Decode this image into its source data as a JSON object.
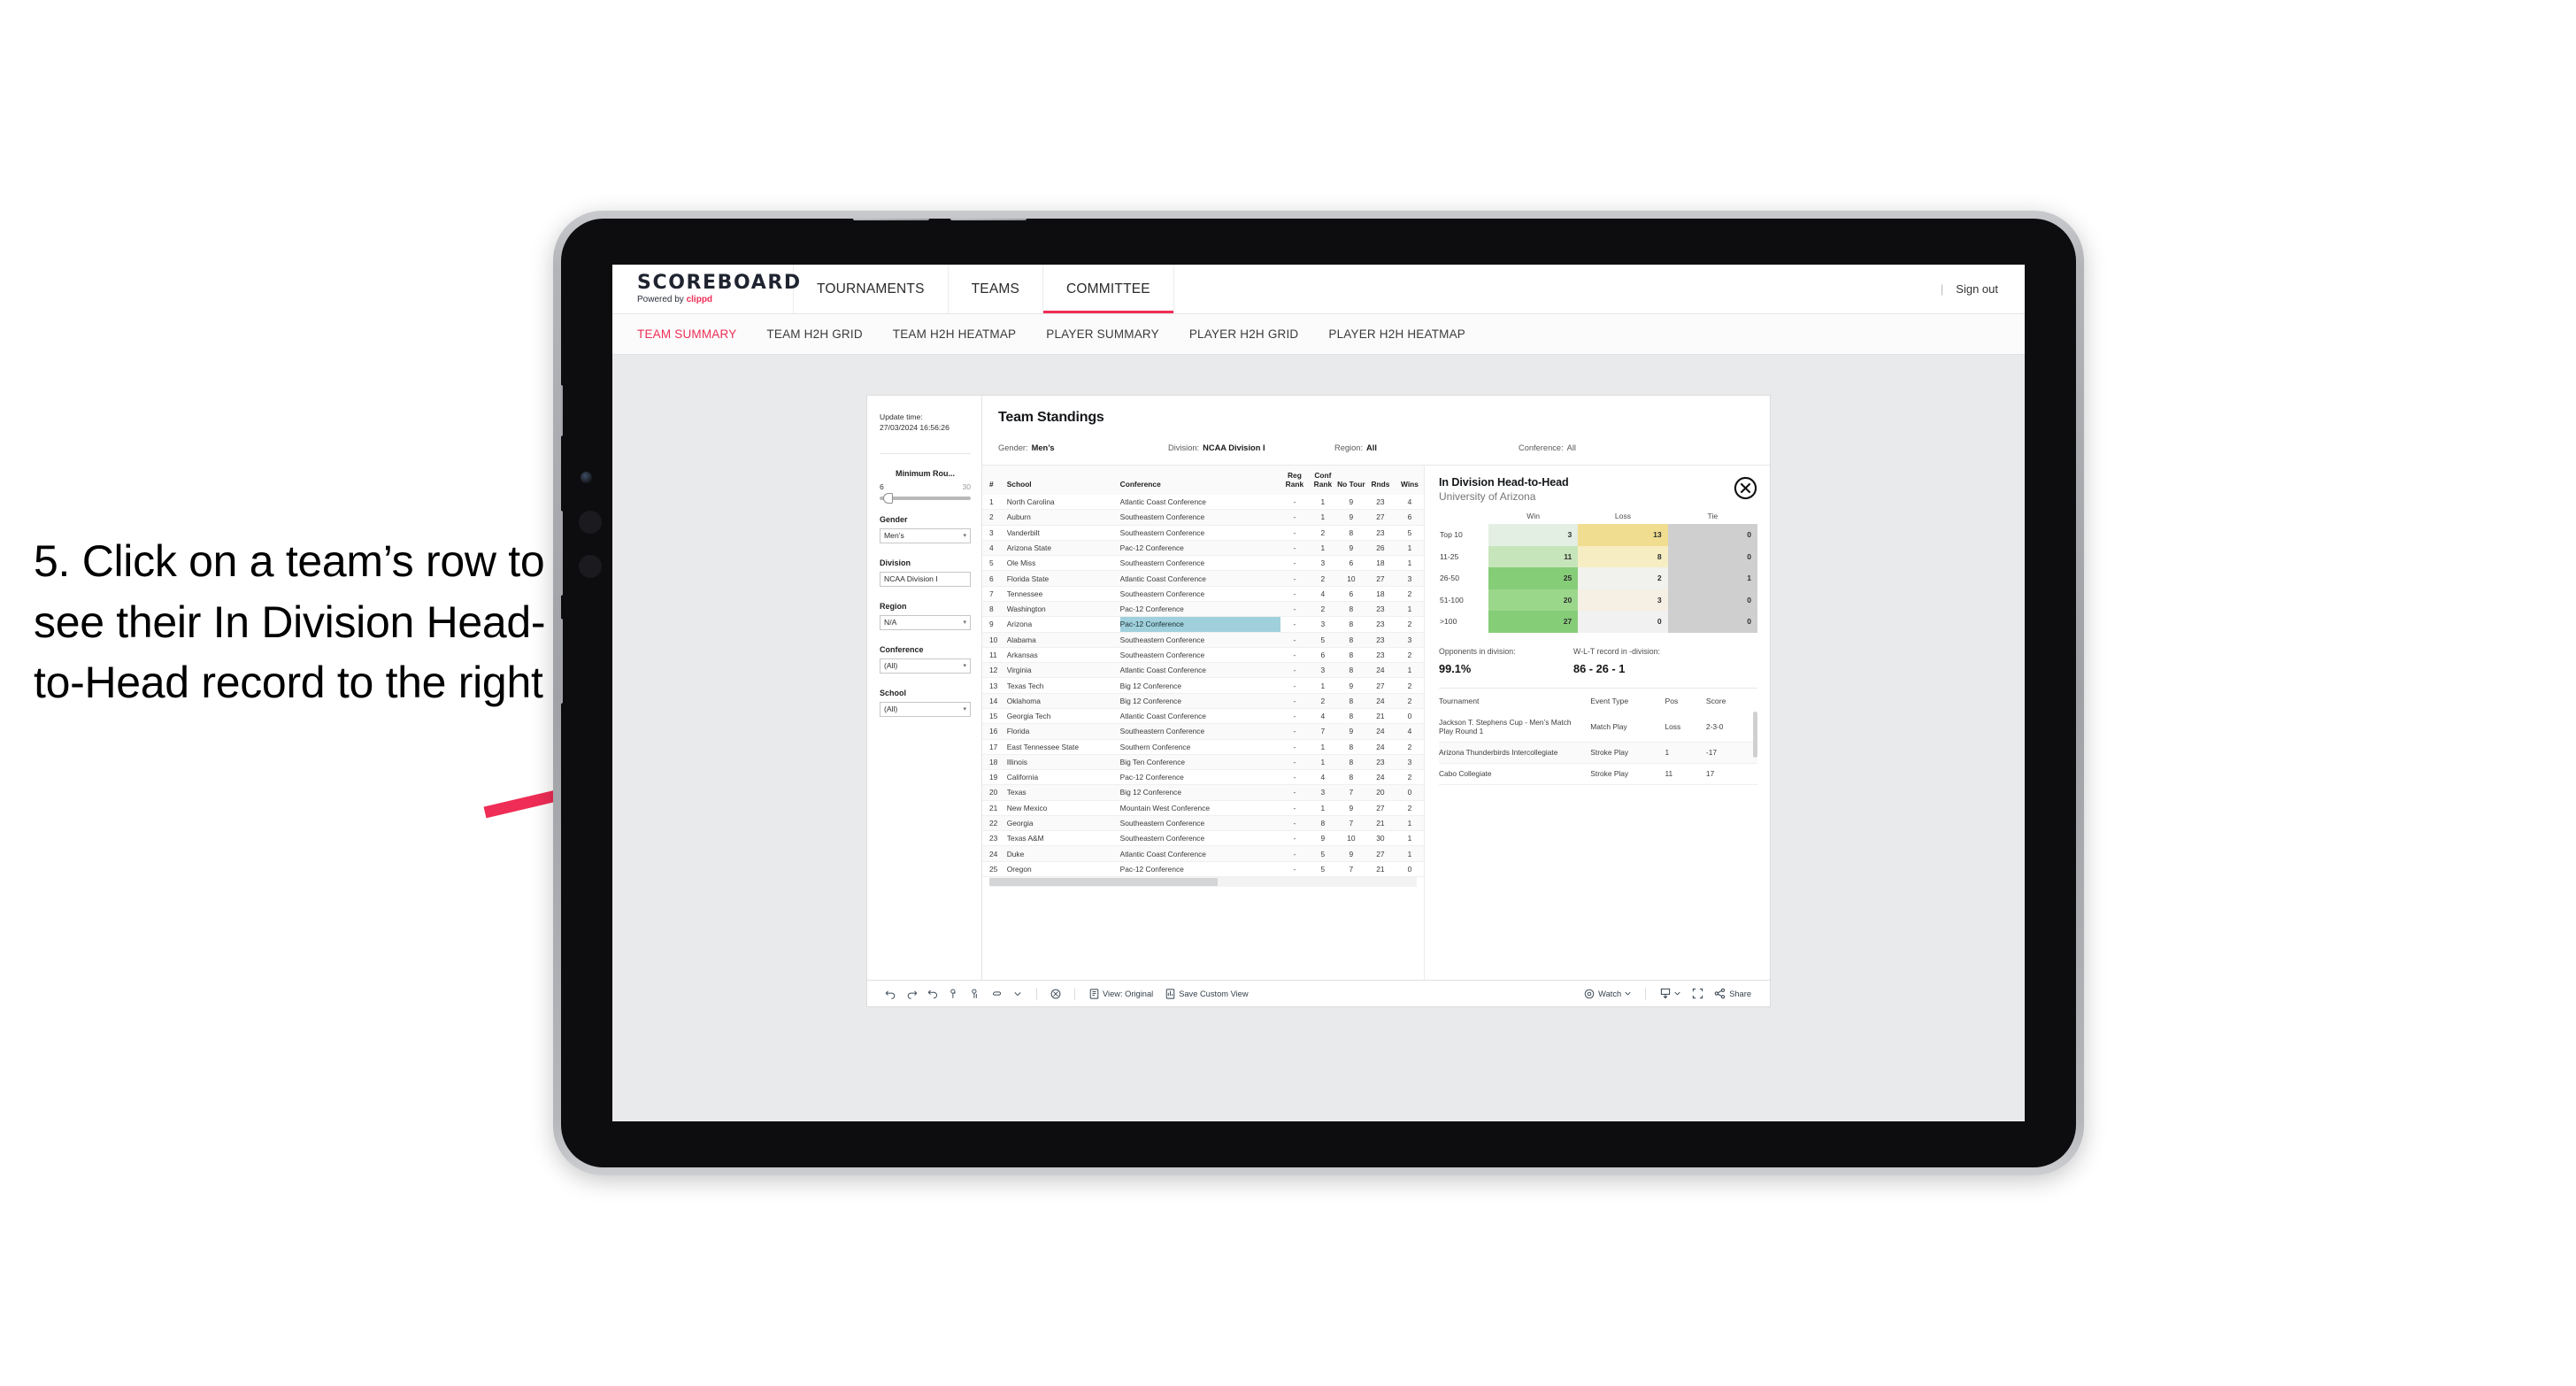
{
  "annotation": {
    "text": "5. Click on a team’s row to see their In Division Head-to-Head record to the right",
    "arrow_color": "#ef2d56"
  },
  "topnav": {
    "brand_title": "SCOREBOARD",
    "brand_sub_prefix": "Powered by ",
    "brand_sub_brand": "clippd",
    "links": [
      {
        "label": "TOURNAMENTS",
        "active": false
      },
      {
        "label": "TEAMS",
        "active": false
      },
      {
        "label": "COMMITTEE",
        "active": true
      }
    ],
    "separator": "|",
    "sign_out": "Sign out"
  },
  "subnav": {
    "tabs": [
      {
        "label": "TEAM SUMMARY",
        "active": true
      },
      {
        "label": "TEAM H2H GRID",
        "active": false
      },
      {
        "label": "TEAM H2H HEATMAP",
        "active": false
      },
      {
        "label": "PLAYER SUMMARY",
        "active": false
      },
      {
        "label": "PLAYER H2H GRID",
        "active": false
      },
      {
        "label": "PLAYER H2H HEATMAP",
        "active": false
      }
    ]
  },
  "sidebar": {
    "update_time_label": "Update time:",
    "update_time_value": "27/03/2024 16:56:26",
    "slider": {
      "label": "Minimum Rou...",
      "min": "6",
      "max": "30",
      "value_pct": 4
    },
    "filters": [
      {
        "label": "Gender",
        "value": "Men’s",
        "caret": "▾"
      },
      {
        "label": "Division",
        "value": "NCAA Division I",
        "caret": ""
      },
      {
        "label": "Region",
        "value": "N/A",
        "caret": "▾"
      },
      {
        "label": "Conference",
        "value": "(All)",
        "caret": "▾"
      },
      {
        "label": "School",
        "value": "(All)",
        "caret": "▾"
      }
    ]
  },
  "standings": {
    "title": "Team Standings",
    "meta": [
      {
        "key": "Gender:",
        "value": "Men’s"
      },
      {
        "key": "Division:",
        "value": "NCAA Division I"
      },
      {
        "key": "Region:",
        "value": "All"
      },
      {
        "key": "Conference:",
        "value": "All"
      }
    ],
    "columns": [
      "#",
      "School",
      "Conference",
      "Reg Rank",
      "Conf Rank",
      "No Tour",
      "Rnds",
      "Wins"
    ],
    "rows": [
      {
        "rank": "1",
        "school": "North Carolina",
        "conf": "Atlantic Coast Conference",
        "reg": "-",
        "cfr": "1",
        "notour": "9",
        "rnds": "23",
        "wins": "4"
      },
      {
        "rank": "2",
        "school": "Auburn",
        "conf": "Southeastern Conference",
        "reg": "-",
        "cfr": "1",
        "notour": "9",
        "rnds": "27",
        "wins": "6"
      },
      {
        "rank": "3",
        "school": "Vanderbilt",
        "conf": "Southeastern Conference",
        "reg": "-",
        "cfr": "2",
        "notour": "8",
        "rnds": "23",
        "wins": "5"
      },
      {
        "rank": "4",
        "school": "Arizona State",
        "conf": "Pac-12 Conference",
        "reg": "-",
        "cfr": "1",
        "notour": "9",
        "rnds": "26",
        "wins": "1"
      },
      {
        "rank": "5",
        "school": "Ole Miss",
        "conf": "Southeastern Conference",
        "reg": "-",
        "cfr": "3",
        "notour": "6",
        "rnds": "18",
        "wins": "1"
      },
      {
        "rank": "6",
        "school": "Florida State",
        "conf": "Atlantic Coast Conference",
        "reg": "-",
        "cfr": "2",
        "notour": "10",
        "rnds": "27",
        "wins": "3"
      },
      {
        "rank": "7",
        "school": "Tennessee",
        "conf": "Southeastern Conference",
        "reg": "-",
        "cfr": "4",
        "notour": "6",
        "rnds": "18",
        "wins": "2"
      },
      {
        "rank": "8",
        "school": "Washington",
        "conf": "Pac-12 Conference",
        "reg": "-",
        "cfr": "2",
        "notour": "8",
        "rnds": "23",
        "wins": "1"
      },
      {
        "rank": "9",
        "school": "Arizona",
        "conf": "Pac-12 Conference",
        "reg": "-",
        "cfr": "3",
        "notour": "8",
        "rnds": "23",
        "wins": "2",
        "selected": true
      },
      {
        "rank": "10",
        "school": "Alabama",
        "conf": "Southeastern Conference",
        "reg": "-",
        "cfr": "5",
        "notour": "8",
        "rnds": "23",
        "wins": "3"
      },
      {
        "rank": "11",
        "school": "Arkansas",
        "conf": "Southeastern Conference",
        "reg": "-",
        "cfr": "6",
        "notour": "8",
        "rnds": "23",
        "wins": "2"
      },
      {
        "rank": "12",
        "school": "Virginia",
        "conf": "Atlantic Coast Conference",
        "reg": "-",
        "cfr": "3",
        "notour": "8",
        "rnds": "24",
        "wins": "1"
      },
      {
        "rank": "13",
        "school": "Texas Tech",
        "conf": "Big 12 Conference",
        "reg": "-",
        "cfr": "1",
        "notour": "9",
        "rnds": "27",
        "wins": "2"
      },
      {
        "rank": "14",
        "school": "Oklahoma",
        "conf": "Big 12 Conference",
        "reg": "-",
        "cfr": "2",
        "notour": "8",
        "rnds": "24",
        "wins": "2"
      },
      {
        "rank": "15",
        "school": "Georgia Tech",
        "conf": "Atlantic Coast Conference",
        "reg": "-",
        "cfr": "4",
        "notour": "8",
        "rnds": "21",
        "wins": "0"
      },
      {
        "rank": "16",
        "school": "Florida",
        "conf": "Southeastern Conference",
        "reg": "-",
        "cfr": "7",
        "notour": "9",
        "rnds": "24",
        "wins": "4"
      },
      {
        "rank": "17",
        "school": "East Tennessee State",
        "conf": "Southern Conference",
        "reg": "-",
        "cfr": "1",
        "notour": "8",
        "rnds": "24",
        "wins": "2"
      },
      {
        "rank": "18",
        "school": "Illinois",
        "conf": "Big Ten Conference",
        "reg": "-",
        "cfr": "1",
        "notour": "8",
        "rnds": "23",
        "wins": "3"
      },
      {
        "rank": "19",
        "school": "California",
        "conf": "Pac-12 Conference",
        "reg": "-",
        "cfr": "4",
        "notour": "8",
        "rnds": "24",
        "wins": "2"
      },
      {
        "rank": "20",
        "school": "Texas",
        "conf": "Big 12 Conference",
        "reg": "-",
        "cfr": "3",
        "notour": "7",
        "rnds": "20",
        "wins": "0"
      },
      {
        "rank": "21",
        "school": "New Mexico",
        "conf": "Mountain West Conference",
        "reg": "-",
        "cfr": "1",
        "notour": "9",
        "rnds": "27",
        "wins": "2"
      },
      {
        "rank": "22",
        "school": "Georgia",
        "conf": "Southeastern Conference",
        "reg": "-",
        "cfr": "8",
        "notour": "7",
        "rnds": "21",
        "wins": "1"
      },
      {
        "rank": "23",
        "school": "Texas A&M",
        "conf": "Southeastern Conference",
        "reg": "-",
        "cfr": "9",
        "notour": "10",
        "rnds": "30",
        "wins": "1"
      },
      {
        "rank": "24",
        "school": "Duke",
        "conf": "Atlantic Coast Conference",
        "reg": "-",
        "cfr": "5",
        "notour": "9",
        "rnds": "27",
        "wins": "1"
      },
      {
        "rank": "25",
        "school": "Oregon",
        "conf": "Pac-12 Conference",
        "reg": "-",
        "cfr": "5",
        "notour": "7",
        "rnds": "21",
        "wins": "0"
      }
    ]
  },
  "detail": {
    "title": "In Division Head-to-Head",
    "subtitle": "University of Arizona",
    "close_icon": "close-circle-icon",
    "chart_data": {
      "type": "heatmap",
      "title": "In Division Head-to-Head",
      "subtitle": "University of Arizona",
      "columns": [
        "Win",
        "Loss",
        "Tie"
      ],
      "rows": [
        "Top 10",
        "11-25",
        "26-50",
        "51-100",
        ">100"
      ],
      "values": [
        [
          3,
          13,
          0
        ],
        [
          11,
          8,
          0
        ],
        [
          25,
          2,
          1
        ],
        [
          20,
          3,
          0
        ],
        [
          27,
          0,
          0
        ]
      ],
      "cell_colors": [
        [
          "#e3efe2",
          "#f0dd8f",
          "#cfcfcf"
        ],
        [
          "#c7e5bb",
          "#f6edc3",
          "#cfcfcf"
        ],
        [
          "#86cd78",
          "#f1f1ee",
          "#cfcfcf"
        ],
        [
          "#9bd78b",
          "#f5f0e3",
          "#cfcfcf"
        ],
        [
          "#86cd78",
          "#f1f1f1",
          "#cfcfcf"
        ]
      ]
    },
    "stats": [
      {
        "label": "Opponents in division:",
        "value": "99.1%"
      },
      {
        "label": "W-L-T record in -division:",
        "value": "86 - 26 - 1"
      }
    ],
    "tournaments": {
      "columns": [
        "Tournament",
        "Event Type",
        "Pos",
        "Score"
      ],
      "rows": [
        {
          "name": "Jackson T. Stephens Cup - Men’s Match Play Round 1",
          "type": "Match Play",
          "pos": "Loss",
          "score": "2-3-0"
        },
        {
          "name": "Arizona Thunderbirds Intercollegiate",
          "type": "Stroke Play",
          "pos": "1",
          "score": "-17"
        },
        {
          "name": "Cabo Collegiate",
          "type": "Stroke Play",
          "pos": "11",
          "score": "17"
        }
      ]
    }
  },
  "toolbar": {
    "icons": [
      "undo-icon",
      "redo-icon",
      "revert-icon",
      "refresh-icon",
      "pause-icon",
      "zoom-icon"
    ],
    "view_label": "View: Original",
    "save_label": "Save Custom View",
    "watch_label": "Watch",
    "share_label": "Share",
    "download_icon": "download-icon",
    "fullscreen_icon": "fullscreen-icon",
    "share_icon": "share-icon",
    "alert_icon": "alert-icon"
  }
}
